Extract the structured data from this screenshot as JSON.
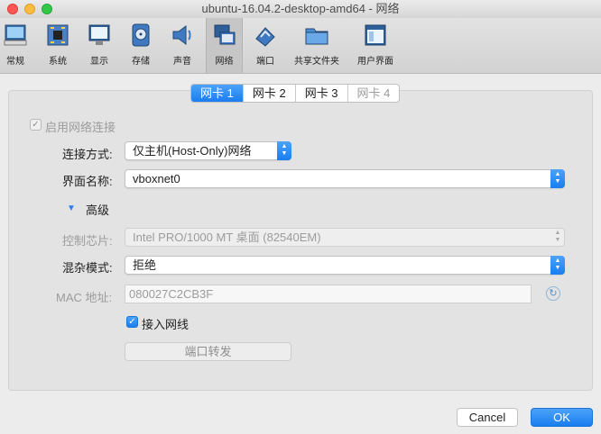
{
  "window": {
    "title": "ubuntu-16.04.2-desktop-amd64 - 网络"
  },
  "toolbar": {
    "items": [
      {
        "label": "常规",
        "icon": "general-icon"
      },
      {
        "label": "系统",
        "icon": "system-icon"
      },
      {
        "label": "显示",
        "icon": "display-icon"
      },
      {
        "label": "存储",
        "icon": "storage-icon"
      },
      {
        "label": "声音",
        "icon": "audio-icon"
      },
      {
        "label": "网络",
        "icon": "network-icon",
        "selected": true
      },
      {
        "label": "端口",
        "icon": "ports-icon"
      },
      {
        "label": "共享文件夹",
        "icon": "shared-folder-icon"
      },
      {
        "label": "用户界面",
        "icon": "user-interface-icon"
      }
    ]
  },
  "tabs": [
    "网卡 1",
    "网卡 2",
    "网卡 3",
    "网卡 4"
  ],
  "active_tab": 0,
  "form": {
    "enable_label": "启用网络连接",
    "enable_checked": true,
    "attached_label": "连接方式:",
    "attached_value": "仅主机(Host-Only)网络",
    "name_label": "界面名称:",
    "name_value": "vboxnet0",
    "advanced_label": "高级",
    "adapter_label": "控制芯片:",
    "adapter_value": "Intel PRO/1000 MT 桌面 (82540EM)",
    "promisc_label": "混杂模式:",
    "promisc_value": "拒绝",
    "mac_label": "MAC 地址:",
    "mac_value": "080027C2CB3F",
    "cable_label": "接入网线",
    "cable_checked": true,
    "port_forward_label": "端口转发"
  },
  "buttons": {
    "cancel": "Cancel",
    "ok": "OK"
  },
  "colors": {
    "accent": "#1a7ef0"
  }
}
